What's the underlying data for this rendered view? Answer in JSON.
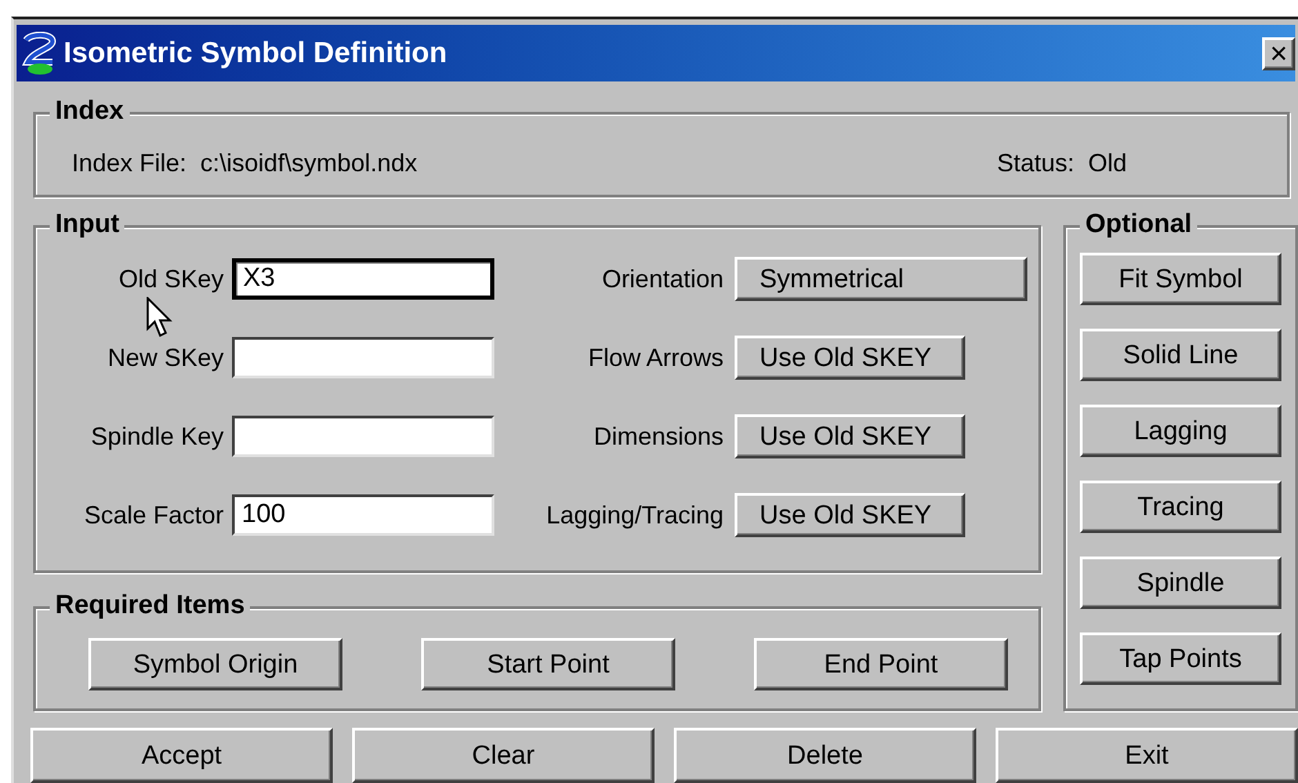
{
  "window": {
    "title": "Isometric Symbol Definition",
    "close": "×"
  },
  "index": {
    "title": "Index",
    "file_label": "Index File:",
    "file": "c:\\isoidf\\symbol.ndx",
    "status_label": "Status:",
    "status": "Old"
  },
  "input": {
    "title": "Input",
    "fields": [
      {
        "label": "Old SKey",
        "value": "X3",
        "focused": true
      },
      {
        "label": "New SKey",
        "focused": false
      },
      {
        "label": "Spindle Key",
        "focused": false
      },
      {
        "label": "Scale Factor",
        "value": "100",
        "focused": false
      }
    ],
    "options": [
      {
        "label": "Orientation",
        "value": "Symmetrical",
        "kind": "long"
      },
      {
        "label": "Flow Arrows",
        "value": "Use Old SKEY",
        "kind": "short"
      },
      {
        "label": "Dimensions",
        "value": "Use Old SKEY",
        "kind": "short"
      },
      {
        "label": "Lagging/Tracing",
        "value": "Use Old SKEY",
        "kind": "short"
      }
    ]
  },
  "required": {
    "title": "Required Items",
    "buttons": [
      "Symbol Origin",
      "Start Point",
      "End Point"
    ]
  },
  "optional": {
    "title": "Optional",
    "buttons": [
      "Fit Symbol",
      "Solid Line",
      "Lagging",
      "Tracing",
      "Spindle",
      "Tap Points"
    ]
  },
  "actions": [
    "Accept",
    "Clear",
    "Delete",
    "Exit"
  ]
}
